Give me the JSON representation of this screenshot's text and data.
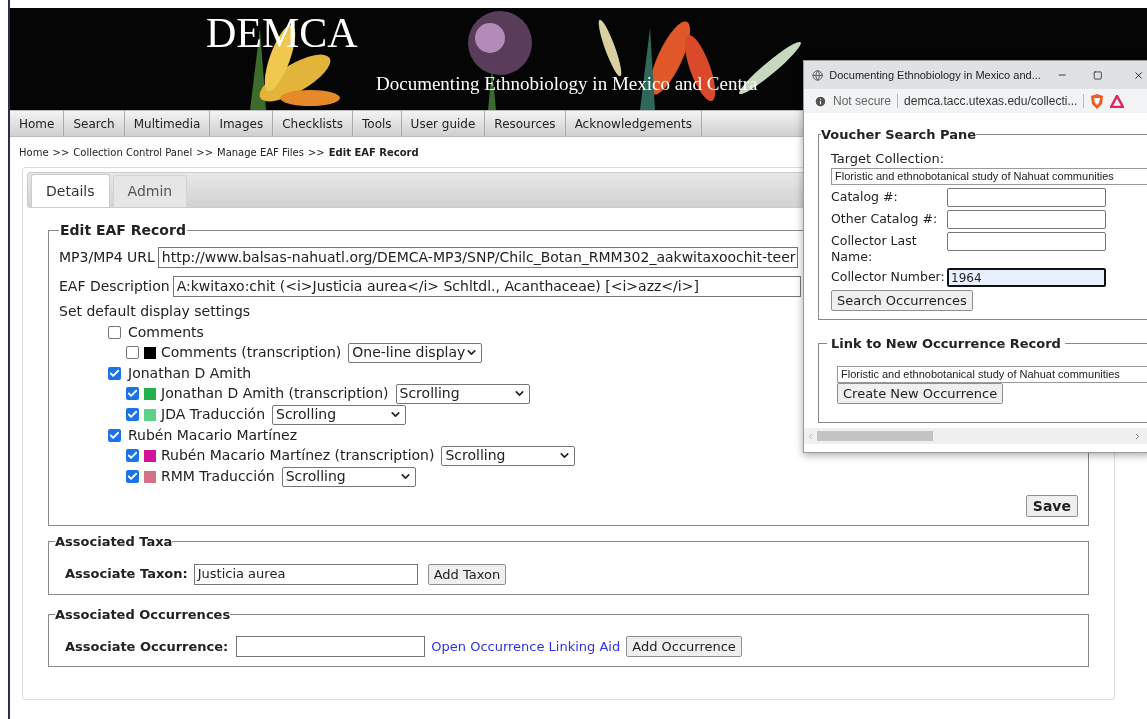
{
  "header": {
    "title": "DEMCA",
    "subtitle": "Documenting Ethnobiology in Mexico and Centra"
  },
  "nav": [
    "Home",
    "Search",
    "Multimedia",
    "Images",
    "Checklists",
    "Tools",
    "User guide",
    "Resources",
    "Acknowledgements"
  ],
  "breadcrumb": [
    {
      "label": "Home",
      "current": false
    },
    {
      "label": "Collection Control Panel",
      "current": false
    },
    {
      "label": "Manage EAF Files",
      "current": false
    },
    {
      "label": "Edit EAF Record",
      "current": true
    }
  ],
  "breadcrumb_separator": ">>",
  "tabs": [
    {
      "label": "Details",
      "selected": true
    },
    {
      "label": "Admin",
      "selected": false
    }
  ],
  "edit_record": {
    "legend": "Edit EAF Record",
    "url_label": "MP3/MP4 URL",
    "url_value": "http://www.balsas-nahuatl.org/DEMCA-MP3/SNP/Chilc_Botan_RMM302_aakwitaxoochit-teer",
    "description_label": "EAF Description",
    "description_value": "A:kwitaxo:chit (<i>Justicia aurea</i> Schltdl., Acanthaceae) [<i>azz</i>]",
    "settings_label": "Set default display settings",
    "tiers": [
      {
        "label": "Comments",
        "checked": false,
        "children": [
          {
            "label": "Comments (transcription)",
            "checked": false,
            "color": "#000000",
            "display": "One-line display"
          }
        ]
      },
      {
        "label": "Jonathan D Amith",
        "checked": true,
        "children": [
          {
            "label": "Jonathan D Amith (transcription)",
            "checked": true,
            "color": "#22b24c",
            "display": "Scrolling"
          },
          {
            "label": "JDA Traducción",
            "checked": true,
            "color": "#5fcf8c",
            "display": "Scrolling"
          }
        ]
      },
      {
        "label": "Rubén Macario Martínez",
        "checked": true,
        "children": [
          {
            "label": "Rubén Macario Martínez (transcription)",
            "checked": true,
            "color": "#d4139a",
            "display": "Scrolling"
          },
          {
            "label": "RMM Traducción",
            "checked": true,
            "color": "#d46f86",
            "display": "Scrolling"
          }
        ]
      }
    ],
    "save": "Save"
  },
  "taxa": {
    "legend": "Associated Taxa",
    "label": "Associate Taxon:",
    "value": "Justicia aurea",
    "button": "Add Taxon"
  },
  "occurrences": {
    "legend": "Associated Occurrences",
    "label": "Associate Occurrence:",
    "link": "Open Occurrence Linking Aid",
    "button": "Add Occurrence"
  },
  "popup": {
    "title": "Documenting Ethnobiology in Mexico and...",
    "security": "Not secure",
    "url": "demca.tacc.utexas.edu/collecti...",
    "voucher": {
      "legend": "Voucher Search Pane",
      "target_label": "Target Collection:",
      "target_value": "Floristic and ethnobotanical study of Nahuat communities",
      "fields": [
        {
          "label": "Catalog #:",
          "focused": false
        },
        {
          "label": "Other Catalog #:",
          "focused": false
        },
        {
          "label": "Collector Last Name:",
          "focused": false
        },
        {
          "label": "Collector Number:",
          "value": "1964",
          "focused": true
        }
      ],
      "button": "Search Occurrences"
    },
    "link_section": {
      "legend": "Link to New Occurrence Record",
      "select_value": "Floristic and ethnobotanical study of Nahuat communities",
      "button": "Create New Occurrence"
    }
  }
}
